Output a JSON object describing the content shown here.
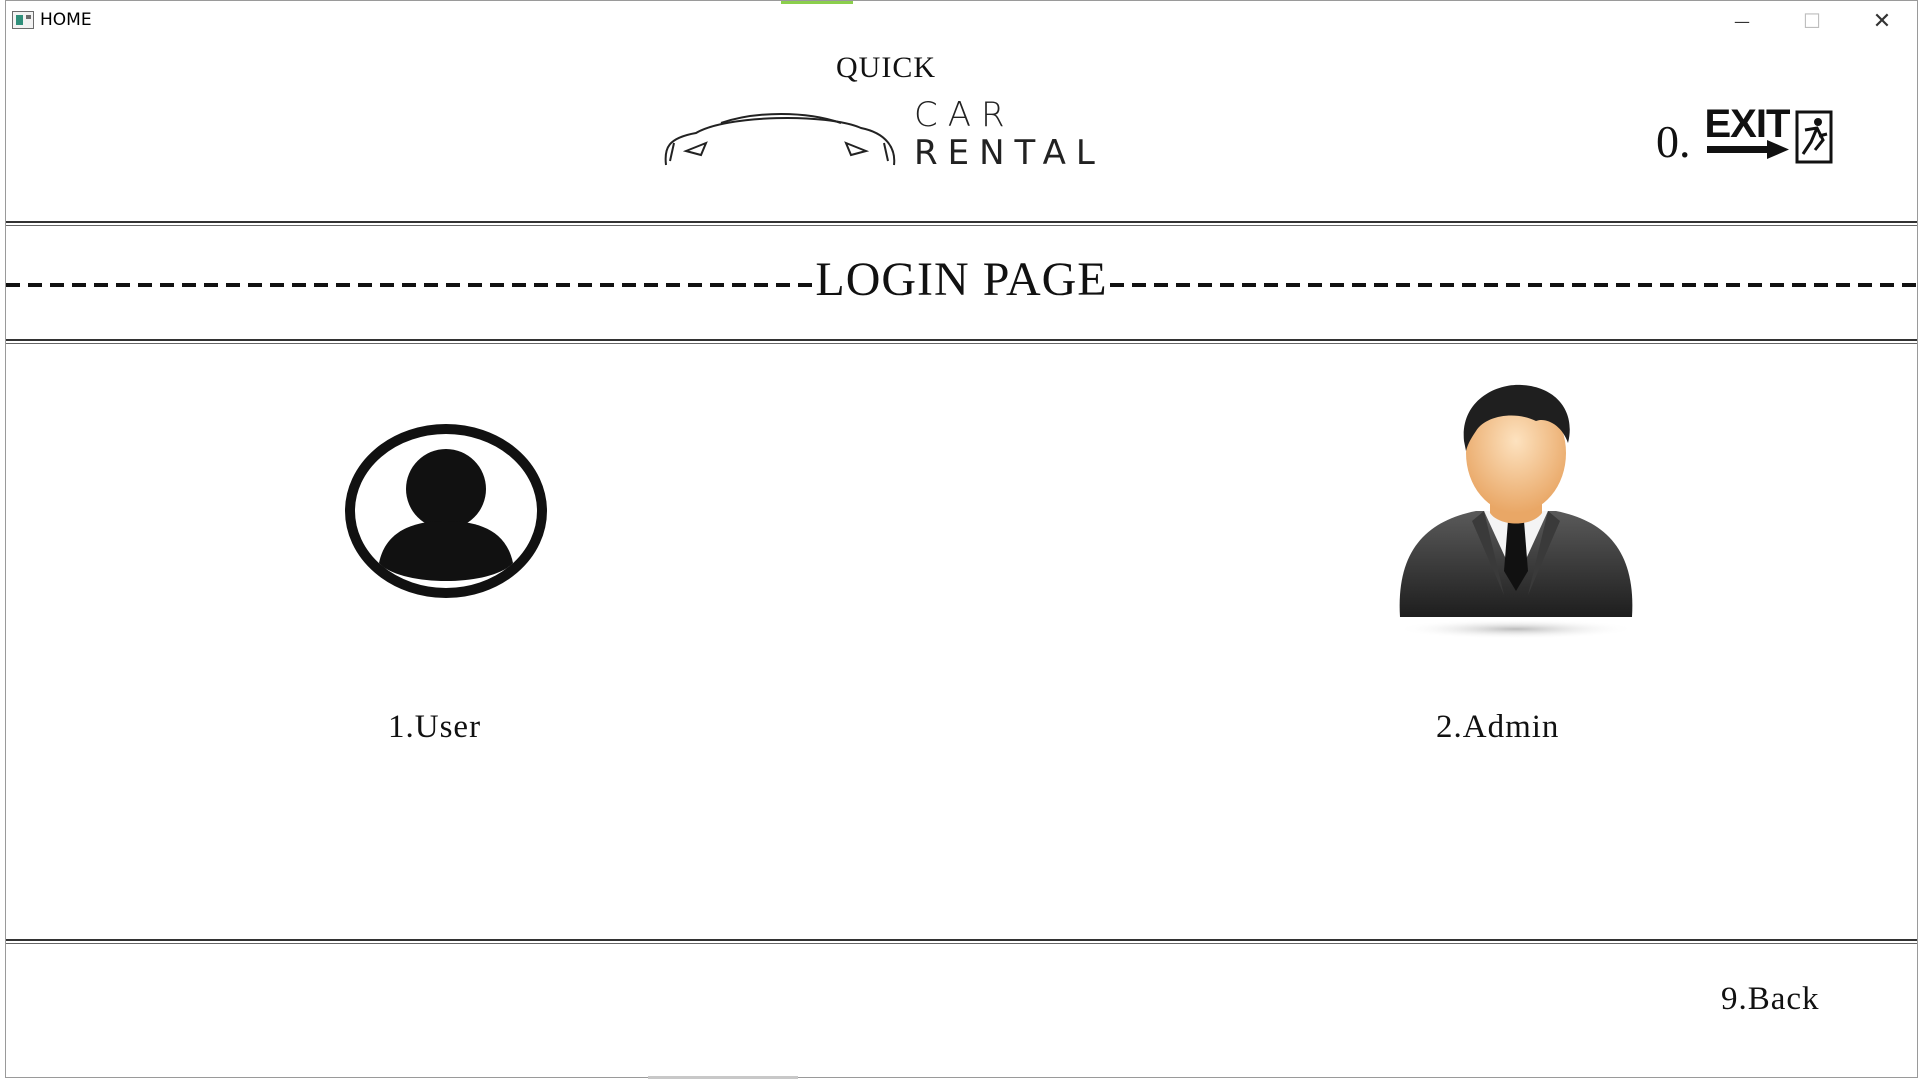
{
  "window": {
    "title": "HOME",
    "minimize_glyph": "—",
    "maximize_glyph": "☐",
    "close_glyph": "✕"
  },
  "logo": {
    "line1": "QUICK",
    "line2": "CAR",
    "line3": "RENTAL"
  },
  "exit": {
    "number": "0.",
    "sign_text": "EXIT",
    "icon": "exit-sign-icon"
  },
  "banner": {
    "title": "LOGIN PAGE"
  },
  "options": {
    "user_label": "1.User",
    "user_icon": "user-circle-icon",
    "admin_label": "2.Admin",
    "admin_icon": "businessman-avatar-icon",
    "back_label": "9.Back"
  }
}
